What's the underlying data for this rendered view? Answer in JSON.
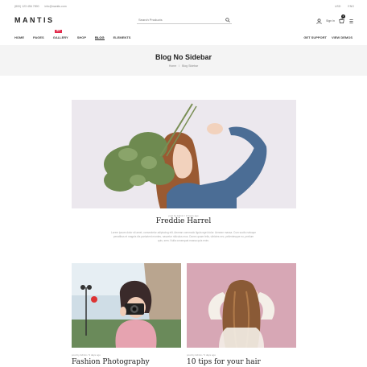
{
  "topbar": {
    "phone": "(800) 123 456 7890",
    "email": "info@mantis.com",
    "currency": "USD",
    "language": "ENG"
  },
  "brand": {
    "logo": "MANTIS"
  },
  "search": {
    "placeholder": "Search Products"
  },
  "header": {
    "signin": "Sign In",
    "cart_count": "0"
  },
  "nav": {
    "items": [
      "HOME",
      "PAGES",
      "GALLERY",
      "SHOP",
      "BLOG",
      "ELEMENTS"
    ],
    "hot_label": "HOT",
    "right": [
      "GET SUPPORT",
      "VIEW DEMOS"
    ]
  },
  "page": {
    "title": "Blog No Sidebar",
    "breadcrumb": [
      "Home",
      "/",
      "Blog Sidebar"
    ]
  },
  "featured": {
    "meta": "post by Admin / 3 hours ago",
    "title": "Freddie Harrel",
    "excerpt": "Lorem ipsum dolor sit amet, consectetur adipiscing elit. Aenean commodo ligula eget dolor. Aenean massa. Cum sociis natoque penatibus et magnis dis parturient montes, nascetur ridiculus mus. Donec quam felis, ultricies nec, pellentesque eu, pretium quis, sem. Nulla consequat massa quis enim."
  },
  "posts": [
    {
      "meta": "post by Admin / 3 days ago",
      "title": "Fashion Photography"
    },
    {
      "meta": "post by Admin / 3 days ago",
      "title": "10 tips for your hair"
    }
  ]
}
